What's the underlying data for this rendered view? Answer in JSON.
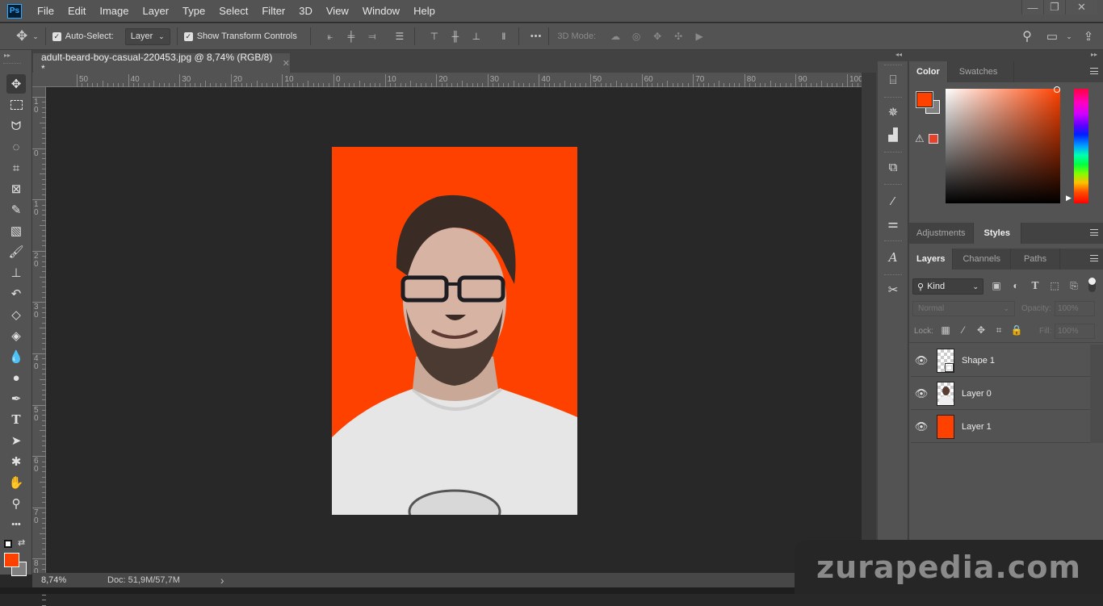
{
  "app": {
    "logo": "Ps"
  },
  "menu": [
    "File",
    "Edit",
    "Image",
    "Layer",
    "Type",
    "Select",
    "Filter",
    "3D",
    "View",
    "Window",
    "Help"
  ],
  "window_controls": {
    "minimize": "—",
    "restore": "❐",
    "close": "✕"
  },
  "options": {
    "auto_select_label": "Auto-Select:",
    "auto_select_checked": true,
    "auto_select_target": "Layer",
    "show_transform_label": "Show Transform Controls",
    "show_transform_checked": true,
    "mode_3d_label": "3D Mode:",
    "more": "•••"
  },
  "document": {
    "tab_title": "adult-beard-boy-casual-220453.jpg @ 8,74% (RGB/8) *",
    "close_glyph": "✕",
    "background_color": "#ff4100",
    "subject": "smiling bearded man with glasses in white t-shirt"
  },
  "rulers": {
    "top": [
      "50",
      "40",
      "30",
      "20",
      "10",
      "0",
      "10",
      "20",
      "30",
      "40",
      "50",
      "60",
      "70",
      "80",
      "90",
      "100"
    ],
    "left": [
      "1 0",
      "0",
      "1 0",
      "2 0",
      "3 0",
      "4 0",
      "5 0",
      "6 0",
      "7 0",
      "8 0"
    ]
  },
  "tools": [
    "move-tool",
    "rectangular-marquee-tool",
    "lasso-tool",
    "quick-selection-tool",
    "crop-tool",
    "frame-tool",
    "eyedropper-tool",
    "healing-brush-tool",
    "brush-tool",
    "clone-stamp-tool",
    "history-brush-tool",
    "eraser-tool",
    "paint-bucket-tool",
    "blur-tool",
    "dodge-tool",
    "pen-tool",
    "type-tool",
    "path-selection-tool",
    "custom-shape-tool",
    "hand-tool",
    "zoom-tool",
    "edit-toolbar"
  ],
  "colors": {
    "foreground": "#ff4100",
    "background": "#808080"
  },
  "status": {
    "zoom": "8,74%",
    "doc_size": "Doc: 51,9M/57,7M",
    "arrow": "›"
  },
  "panels": {
    "color_tabs": [
      {
        "label": "Color",
        "active": true
      },
      {
        "label": "Swatches",
        "active": false
      }
    ],
    "adjust_tabs": [
      {
        "label": "Adjustments",
        "active": false
      },
      {
        "label": "Styles",
        "active": true
      }
    ],
    "layer_tabs": [
      {
        "label": "Layers",
        "active": true
      },
      {
        "label": "Channels",
        "active": false
      },
      {
        "label": "Paths",
        "active": false
      }
    ],
    "filter_kind": "Kind",
    "blend_mode": "Normal",
    "opacity_label": "Opacity:",
    "opacity_value": "100%",
    "lock_label": "Lock:",
    "fill_label": "Fill:",
    "fill_value": "100%",
    "layers": [
      {
        "name": "Shape 1",
        "visible": true,
        "thumb": "shape"
      },
      {
        "name": "Layer 0",
        "visible": true,
        "thumb": "photo"
      },
      {
        "name": "Layer 1",
        "visible": true,
        "thumb": "fill"
      }
    ]
  },
  "watermark": "zurapedia.com"
}
